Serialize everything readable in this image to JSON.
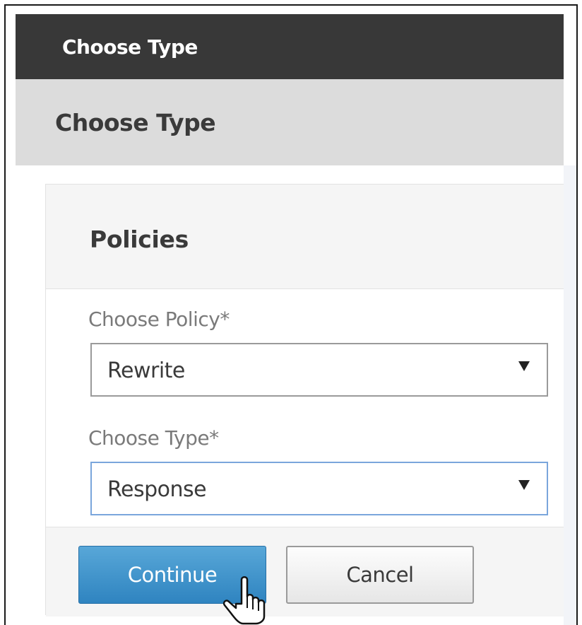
{
  "window": {
    "title": "Choose Type"
  },
  "section": {
    "title": "Choose Type"
  },
  "panel": {
    "title": "Policies"
  },
  "form": {
    "policy": {
      "label": "Choose Policy*",
      "value": "Rewrite"
    },
    "type": {
      "label": "Choose Type*",
      "value": "Response"
    }
  },
  "buttons": {
    "continue_label": "Continue",
    "cancel_label": "Cancel"
  },
  "cursor": {
    "icon": "hand-pointer-icon"
  },
  "colors": {
    "topbar": "#383838",
    "primary_button": "#3a90c8",
    "focus_border": "#7aa6dc"
  }
}
